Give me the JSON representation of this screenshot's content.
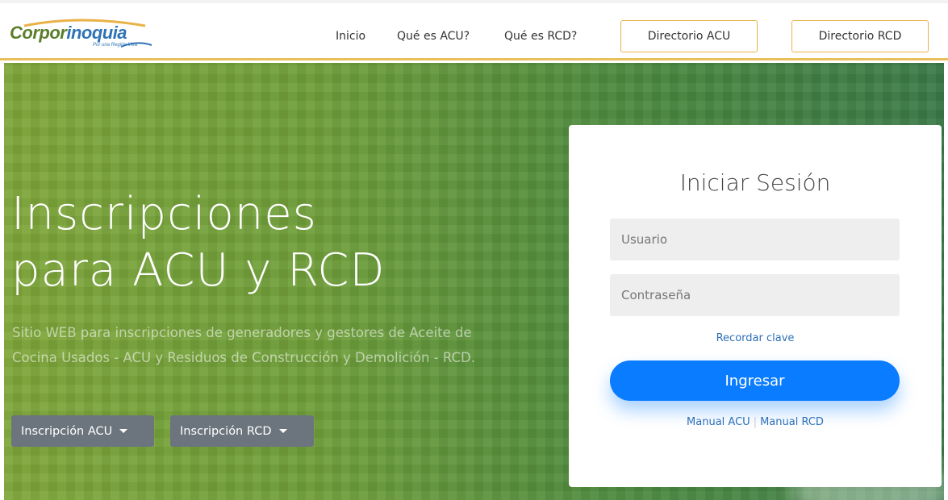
{
  "brand": {
    "name_part1": "Corpor",
    "name_part2": "inoquia",
    "slogan": "Por una Región Viva"
  },
  "nav": {
    "links": [
      "Inicio",
      "Qué es ACU?",
      "Qué es RCD?"
    ],
    "buttons": [
      "Directorio ACU",
      "Directorio RCD"
    ]
  },
  "hero": {
    "title_line1": "Inscripciones",
    "title_line2": "para ACU y RCD",
    "description": "Sitio WEB para inscripciones de generadores y gestores de Aceite de Cocina Usados - ACU y Residuos de Construcción y Demolición - RCD.",
    "dropdowns": [
      "Inscripción ACU",
      "Inscripción RCD"
    ]
  },
  "login": {
    "title": "Iniciar Sesión",
    "username_placeholder": "Usuario",
    "password_placeholder": "Contraseña",
    "forgot_label": "Recordar clave",
    "submit_label": "Ingresar",
    "manual_acu": "Manual ACU",
    "manual_rcd": "Manual RCD",
    "manual_separator": "|"
  },
  "colors": {
    "accent_gold": "#e9b247",
    "primary_blue": "#0a7cff",
    "link_blue": "#2c6fb7",
    "dropdown_gray": "#6c757d",
    "hero_green": "#5e9a3c"
  }
}
